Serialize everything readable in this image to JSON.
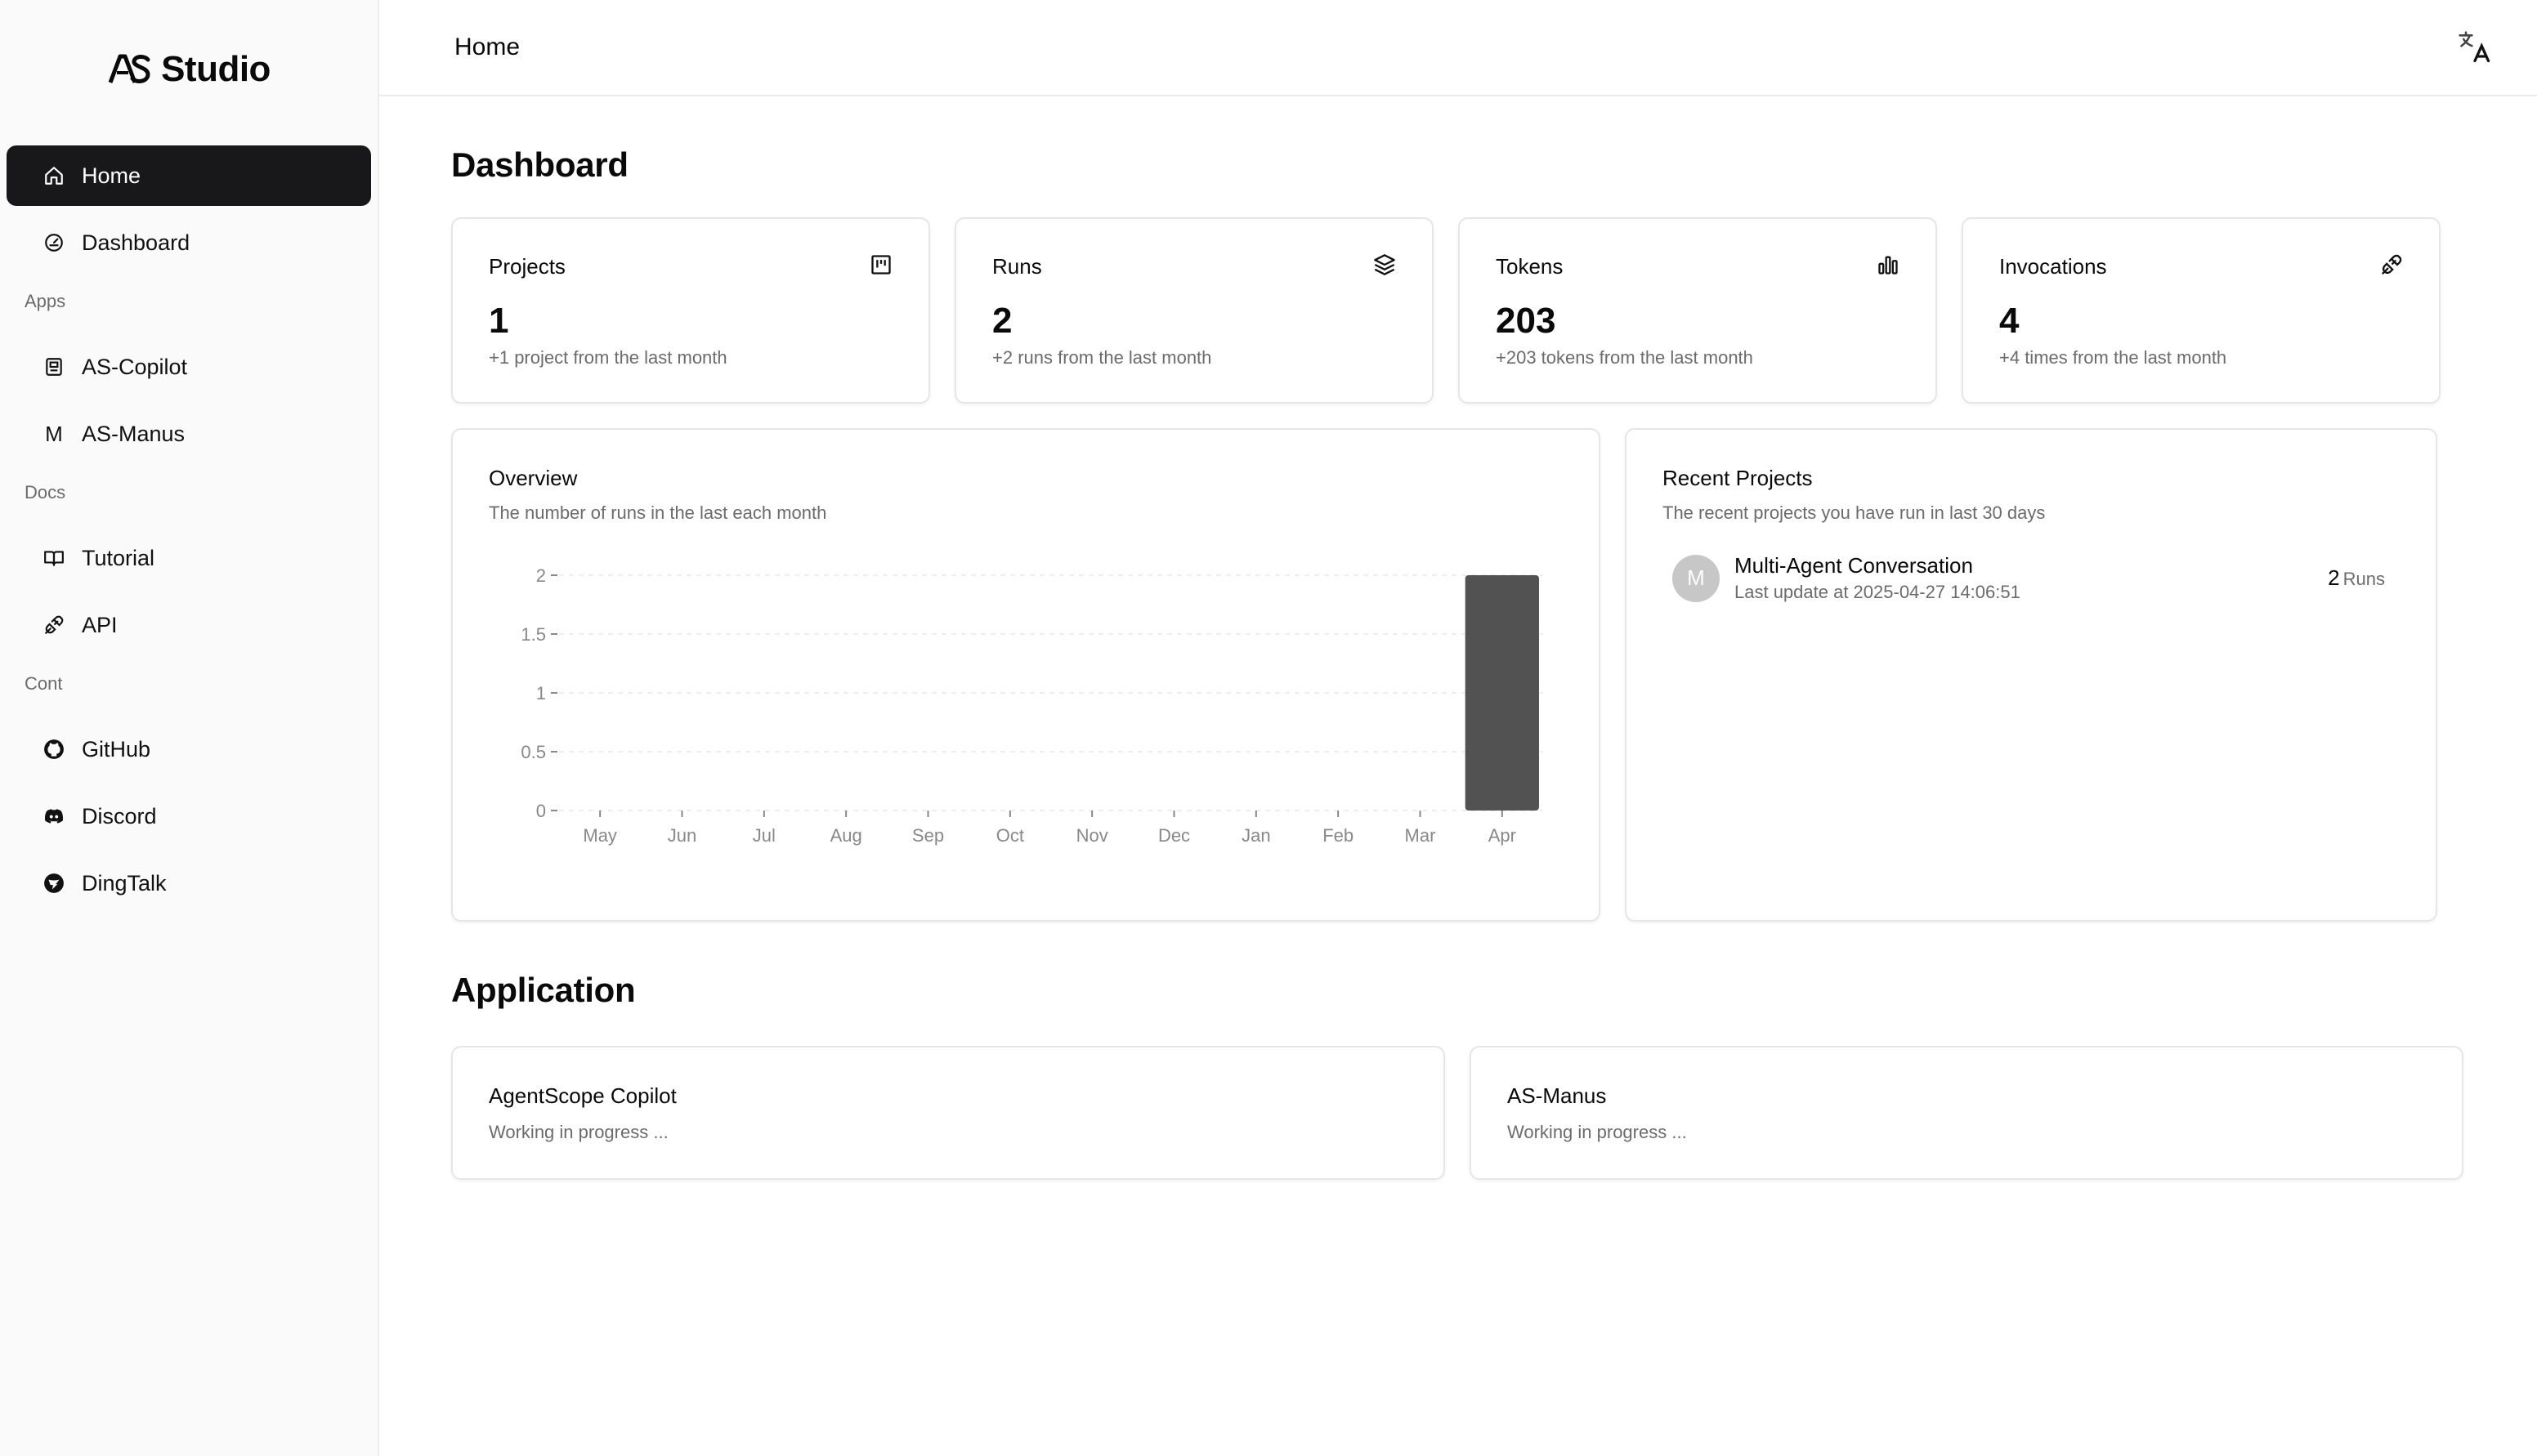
{
  "brand": {
    "name": "Studio",
    "mark": "AS"
  },
  "sidebar": {
    "items": [
      {
        "label": "Home",
        "icon": "home-icon",
        "active": true
      },
      {
        "label": "Dashboard",
        "icon": "gauge-icon"
      }
    ],
    "sections": [
      {
        "label": "Apps",
        "items": [
          {
            "label": "AS-Copilot",
            "icon": "bot-icon"
          },
          {
            "label": "AS-Manus",
            "icon": "letter-m-icon",
            "letter": "M"
          }
        ]
      },
      {
        "label": "Docs",
        "items": [
          {
            "label": "Tutorial",
            "icon": "book-icon"
          },
          {
            "label": "API",
            "icon": "plug-icon"
          }
        ]
      },
      {
        "label": "Cont",
        "items": [
          {
            "label": "GitHub",
            "icon": "github-icon"
          },
          {
            "label": "Discord",
            "icon": "discord-icon"
          },
          {
            "label": "DingTalk",
            "icon": "dingtalk-icon"
          }
        ]
      }
    ]
  },
  "topbar": {
    "title": "Home",
    "language_icon": "translate-icon"
  },
  "dashboard": {
    "title": "Dashboard",
    "stats": [
      {
        "label": "Projects",
        "value": "1",
        "sub": "+1 project from the last month",
        "icon": "kanban-icon"
      },
      {
        "label": "Runs",
        "value": "2",
        "sub": "+2 runs from the last month",
        "icon": "layers-icon"
      },
      {
        "label": "Tokens",
        "value": "203",
        "sub": "+203 tokens from the last month",
        "icon": "bar-chart-icon"
      },
      {
        "label": "Invocations",
        "value": "4",
        "sub": "+4 times from the last month",
        "icon": "plug-icon"
      }
    ],
    "overview": {
      "title": "Overview",
      "subtitle": "The number of runs in the last each month"
    },
    "recent": {
      "title": "Recent Projects",
      "subtitle": "The recent projects you have run in last 30 days",
      "items": [
        {
          "avatar": "M",
          "name": "Multi-Agent Conversation",
          "updated": "Last update at 2025-04-27 14:06:51",
          "runs": "2",
          "runs_unit": "Runs"
        }
      ]
    }
  },
  "application": {
    "title": "Application",
    "apps": [
      {
        "name": "AgentScope Copilot",
        "desc": "Working in progress ..."
      },
      {
        "name": "AS-Manus",
        "desc": "Working in progress ..."
      }
    ]
  },
  "chart_data": {
    "type": "bar",
    "categories": [
      "May",
      "Jun",
      "Jul",
      "Aug",
      "Sep",
      "Oct",
      "Nov",
      "Dec",
      "Jan",
      "Feb",
      "Mar",
      "Apr"
    ],
    "values": [
      0,
      0,
      0,
      0,
      0,
      0,
      0,
      0,
      0,
      0,
      0,
      2
    ],
    "yticks": [
      "0",
      "0.5",
      "1",
      "1.5",
      "2"
    ],
    "ylim": [
      0,
      2
    ],
    "grid": true,
    "bar_color": "#525252"
  }
}
